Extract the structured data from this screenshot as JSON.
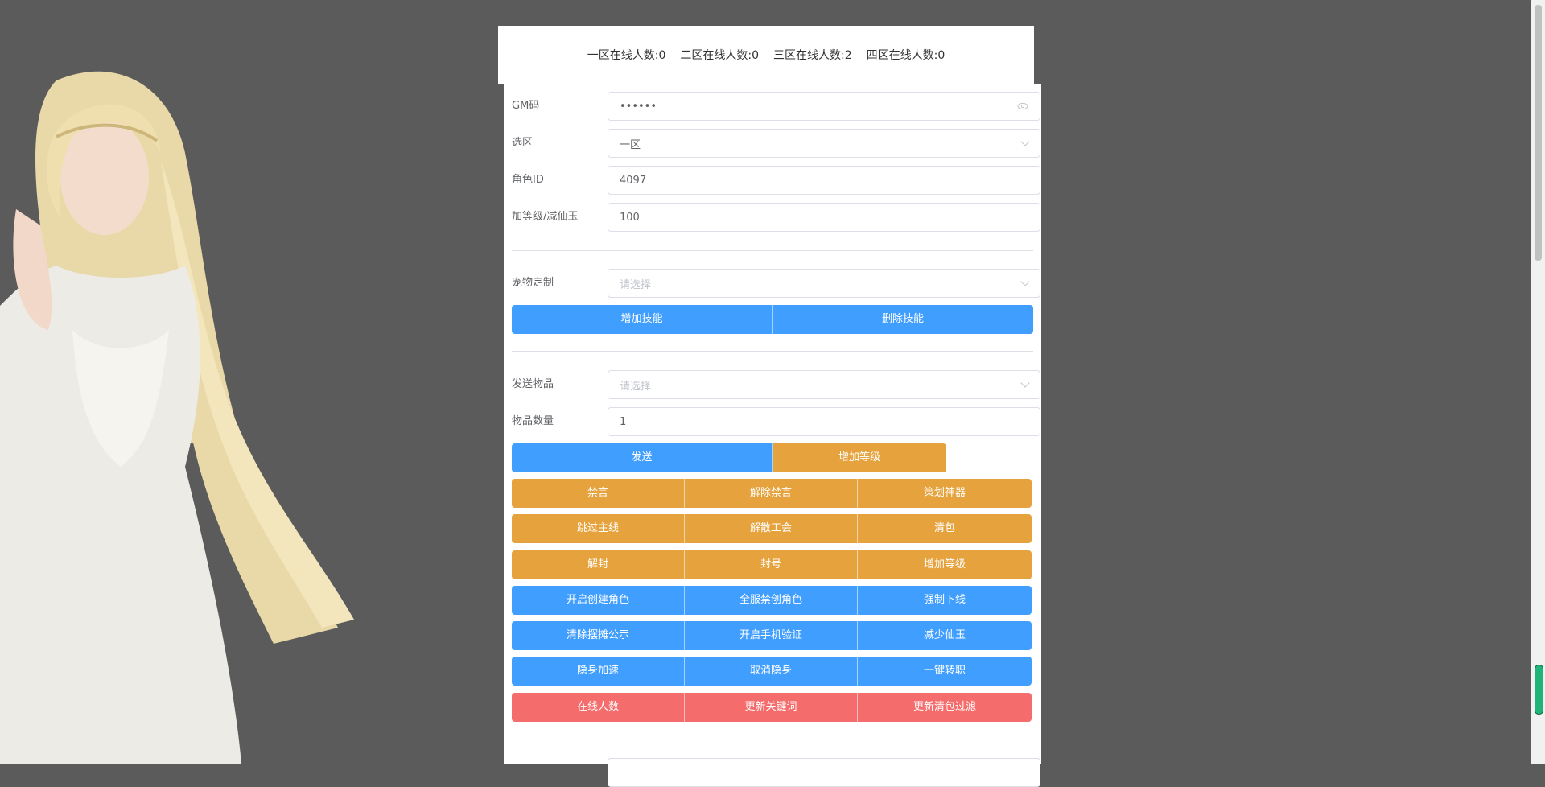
{
  "stats": [
    {
      "label": "一区在线人数:",
      "value": "0"
    },
    {
      "label": "二区在线人数:",
      "value": "0"
    },
    {
      "label": "三区在线人数:",
      "value": "2"
    },
    {
      "label": "四区在线人数:",
      "value": "0"
    }
  ],
  "form": {
    "gm_label": "GM码",
    "gm_value": "••••••",
    "zone_label": "选区",
    "zone_value": "一区",
    "role_label": "角色ID",
    "role_value": "4097",
    "level_label": "加等级/减仙玉",
    "level_value": "100",
    "pet_label": "宠物定制",
    "pet_placeholder": "请选择",
    "item_label": "发送物品",
    "item_placeholder": "请选择",
    "qty_label": "物品数量",
    "qty_value": "1"
  },
  "buttons": {
    "add_skill": "增加技能",
    "del_skill": "删除技能",
    "send": "发送",
    "add_level": "增加等级",
    "r1": [
      "禁言",
      "解除禁言",
      "策划神器"
    ],
    "r2": [
      "跳过主线",
      "解散工会",
      "清包"
    ],
    "r3": [
      "解封",
      "封号",
      "增加等级"
    ],
    "r4": [
      "开启创建角色",
      "全服禁创角色",
      "强制下线"
    ],
    "r5": [
      "清除摆摊公示",
      "开启手机验证",
      "减少仙玉"
    ],
    "r6": [
      "隐身加速",
      "取消隐身",
      "一键转职"
    ],
    "r7": [
      "在线人数",
      "更新关键词",
      "更新清包过滤"
    ]
  },
  "colors": {
    "primary": "#409eff",
    "warning": "#e6a23c",
    "danger": "#f56c6c"
  }
}
